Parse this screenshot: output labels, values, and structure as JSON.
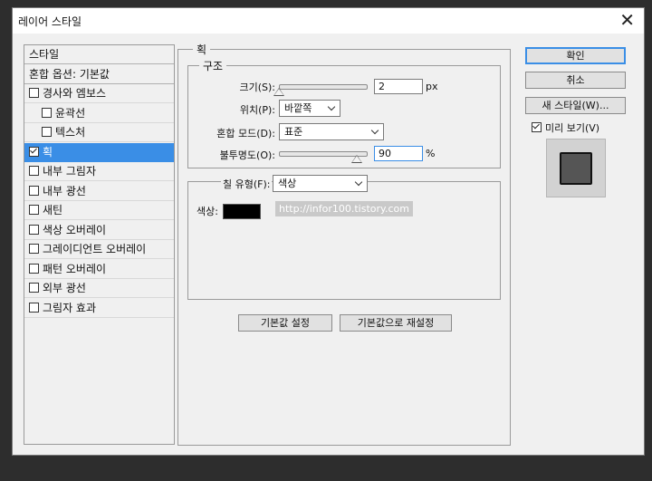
{
  "window": {
    "title": "레이어 스타일"
  },
  "styles_list": {
    "items": [
      {
        "label": "스타일",
        "checkbox": false,
        "checked": false,
        "selected": false,
        "indent": 0
      },
      {
        "label": "혼합 옵션: 기본값",
        "checkbox": false,
        "checked": false,
        "selected": false,
        "indent": 0
      },
      {
        "label": "경사와 엠보스",
        "checkbox": true,
        "checked": false,
        "selected": false,
        "indent": 0
      },
      {
        "label": "윤곽선",
        "checkbox": true,
        "checked": false,
        "selected": false,
        "indent": 1
      },
      {
        "label": "텍스처",
        "checkbox": true,
        "checked": false,
        "selected": false,
        "indent": 1
      },
      {
        "label": "획",
        "checkbox": true,
        "checked": true,
        "selected": true,
        "indent": 0
      },
      {
        "label": "내부 그림자",
        "checkbox": true,
        "checked": false,
        "selected": false,
        "indent": 0
      },
      {
        "label": "내부 광선",
        "checkbox": true,
        "checked": false,
        "selected": false,
        "indent": 0
      },
      {
        "label": "새틴",
        "checkbox": true,
        "checked": false,
        "selected": false,
        "indent": 0
      },
      {
        "label": "색상 오버레이",
        "checkbox": true,
        "checked": false,
        "selected": false,
        "indent": 0
      },
      {
        "label": "그레이디언트 오버레이",
        "checkbox": true,
        "checked": false,
        "selected": false,
        "indent": 0
      },
      {
        "label": "패턴 오버레이",
        "checkbox": true,
        "checked": false,
        "selected": false,
        "indent": 0
      },
      {
        "label": "외부 광선",
        "checkbox": true,
        "checked": false,
        "selected": false,
        "indent": 0
      },
      {
        "label": "그림자 효과",
        "checkbox": true,
        "checked": false,
        "selected": false,
        "indent": 0
      }
    ]
  },
  "stroke": {
    "section_title": "획",
    "structure": {
      "title": "구조",
      "size": {
        "label": "크기(S):",
        "value": "2",
        "unit": "px",
        "slider_fraction": 0.0
      },
      "position": {
        "label": "위치(P):",
        "value": "바깥쪽"
      },
      "blend_mode": {
        "label": "혼합 모드(D):",
        "value": "표준"
      },
      "opacity": {
        "label": "불투명도(O):",
        "value": "90",
        "unit": "%",
        "slider_fraction": 0.9
      }
    },
    "fill": {
      "label": "칠 유형(F):",
      "value": "색상",
      "color_label": "색상:",
      "color": "#000000",
      "watermark": "http://infor100.tistory.com"
    },
    "buttons": {
      "set_default": "기본값 설정",
      "reset_default": "기본값으로 재설정"
    }
  },
  "side": {
    "ok": "확인",
    "cancel": "취소",
    "new_style": "새 스타일(W)...",
    "preview_label": "미리 보기(V)",
    "preview_checked": true
  },
  "colors": {
    "accent": "#3a8ee6",
    "selection_text": "#ffffff",
    "dialog_bg": "#f0f0f0"
  }
}
